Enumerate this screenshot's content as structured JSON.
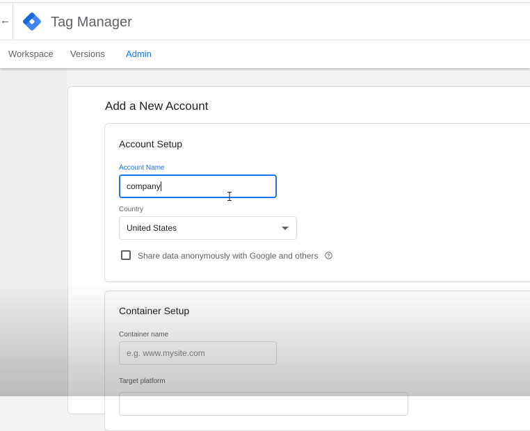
{
  "app": {
    "title": "Tag Manager"
  },
  "nav": {
    "tabs": [
      {
        "label": "Workspace",
        "active": false
      },
      {
        "label": "Versions",
        "active": false
      },
      {
        "label": "Admin",
        "active": true
      }
    ]
  },
  "page": {
    "title": "Add a New Account"
  },
  "account_setup": {
    "title": "Account Setup",
    "account_name_label": "Account Name",
    "account_name_value": "company",
    "country_label": "Country",
    "country_value": "United States",
    "share_data_label": "Share data anonymously with Google and others",
    "share_data_checked": false
  },
  "container_setup": {
    "title": "Container Setup",
    "container_name_label": "Container name",
    "container_name_placeholder": "e.g. www.mysite.com",
    "target_platform_label": "Target platform"
  },
  "colors": {
    "accent": "#1a73e8",
    "logo_blue": "#4285f4",
    "logo_dark": "#1967d2",
    "text_primary": "#202124",
    "text_secondary": "#5f6368"
  },
  "icons": {
    "back": "arrow-left-icon",
    "logo": "tag-manager-logo-icon",
    "dropdown": "caret-down-icon",
    "help": "help-circle-icon"
  }
}
